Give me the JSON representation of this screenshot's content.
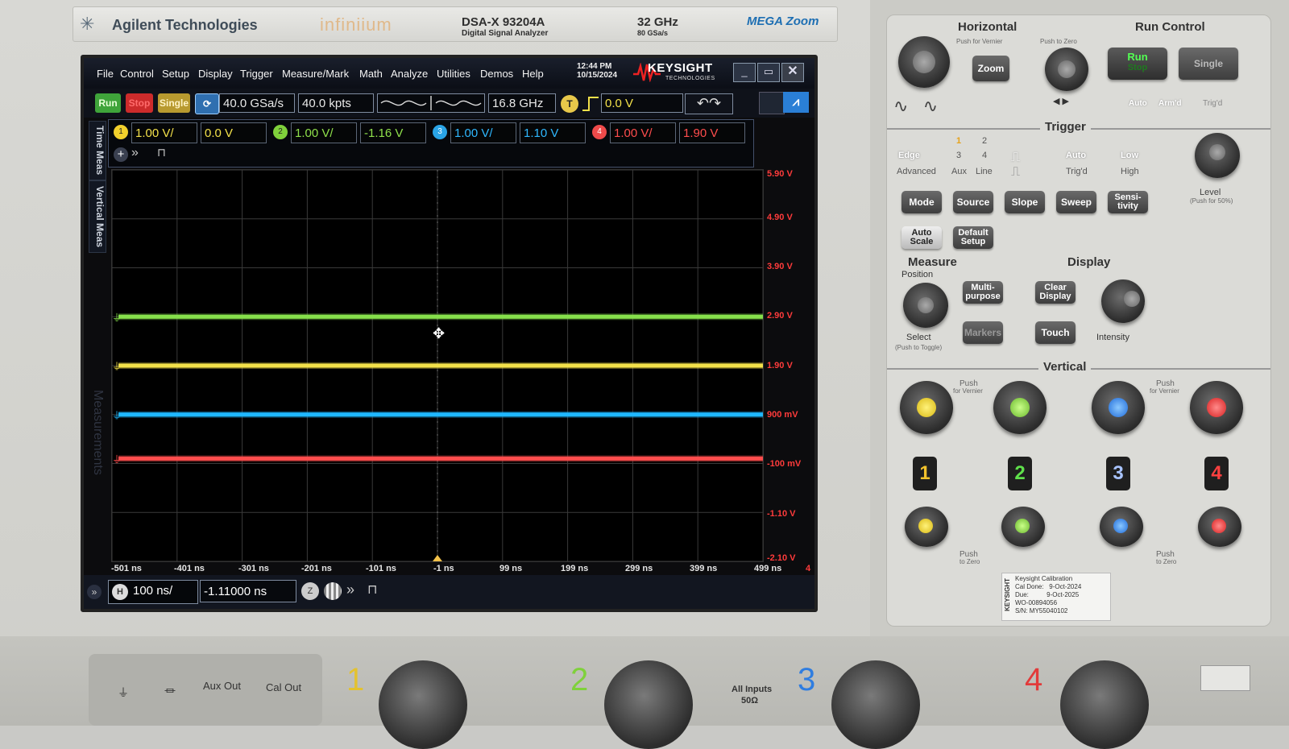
{
  "brand": {
    "company": "Agilent Technologies",
    "product_line": "infiniium",
    "model": "DSA-X 93204A",
    "model_sub": "Digital Signal Analyzer",
    "bandwidth": "32 GHz",
    "rate": "80 GSa/s",
    "megazoom": "MEGA Zoom"
  },
  "menu": [
    "File",
    "Control",
    "Setup",
    "Display",
    "Trigger",
    "Measure/Mark",
    "Math",
    "Analyze",
    "Utilities",
    "Demos",
    "Help"
  ],
  "clock": {
    "time": "12:44 PM",
    "date": "10/15/2024"
  },
  "keysight": {
    "name": "KEYSIGHT",
    "sub": "TECHNOLOGIES"
  },
  "window_buttons": {
    "minimize": "_",
    "restore": "▭",
    "close": "✕"
  },
  "toolbar": {
    "run": "Run",
    "stop": "Stop",
    "single": "Single",
    "sample_rate": "40.0 GSa/s",
    "memory": "40.0 kpts",
    "bandwidth": "16.8 GHz",
    "trigger_badge": "T",
    "trigger_level": "0.0 V"
  },
  "channels": [
    {
      "num": "1",
      "scale": "1.00 V/",
      "offset": "0.0 V",
      "color": "#f2d02c"
    },
    {
      "num": "2",
      "scale": "1.00 V/",
      "offset": "-1.16 V",
      "color": "#7fd13b"
    },
    {
      "num": "3",
      "scale": "1.00 V/",
      "offset": "1.10 V",
      "color": "#2aa4e6"
    },
    {
      "num": "4",
      "scale": "1.00 V/",
      "offset": "1.90 V",
      "color": "#ee4a4a"
    }
  ],
  "side_tabs": {
    "time_meas": "Time Meas",
    "vertical_meas": "Vertical Meas",
    "measurements": "Measurements"
  },
  "plot": {
    "y_labels": [
      "5.90 V",
      "4.90 V",
      "3.90 V",
      "2.90 V",
      "1.90 V",
      "900 mV",
      "-100 mV",
      "-1.10 V",
      "-2.10 V"
    ],
    "x_labels": [
      "-501 ns",
      "-401 ns",
      "-301 ns",
      "-201 ns",
      "-101 ns",
      "-1 ns",
      "99 ns",
      "199 ns",
      "299 ns",
      "399 ns",
      "499 ns"
    ],
    "corner_label": "4",
    "traces": [
      {
        "channel": "2",
        "level_v": 2.9,
        "color": "#86e04b"
      },
      {
        "channel": "1",
        "level_v": 1.9,
        "color": "#f3e14a"
      },
      {
        "channel": "3",
        "level_v": 0.9,
        "color": "#1fb8ff"
      },
      {
        "channel": "4",
        "level_v": 0.0,
        "color": "#ff4d4d"
      }
    ],
    "y_max": 5.9,
    "y_min": -2.1
  },
  "bottom": {
    "h_badge": "H",
    "time_scale": "100 ns/",
    "time_delay": "-1.11000 ns"
  },
  "panel": {
    "horizontal": "Horizontal",
    "run_control": "Run Control",
    "push_vernier": "Push for Vernier",
    "push_zero": "Push to Zero",
    "zoom": "Zoom",
    "run": "Run",
    "stop": "Stop",
    "single": "Single",
    "auto": "Auto",
    "armed": "Arm'd",
    "trigd": "Trig'd",
    "trigger": "Trigger",
    "edge": "Edge",
    "advanced": "Advanced",
    "src1": "1",
    "src2": "2",
    "src3": "3",
    "src4": "4",
    "aux": "Aux",
    "line": "Line",
    "trig_auto": "Auto",
    "trig_trigd": "Trig'd",
    "low": "Low",
    "high": "High",
    "level": "Level",
    "level_sub": "(Push for 50%)",
    "mode": "Mode",
    "source": "Source",
    "slope": "Slope",
    "sweep": "Sweep",
    "sensitivity": "Sensi-tivity",
    "auto_scale": "Auto Scale",
    "default_setup": "Default Setup",
    "measure": "Measure",
    "display": "Display",
    "position": "Position",
    "multipurpose": "Multi-purpose",
    "clear_display": "Clear Display",
    "markers": "Markers",
    "touch": "Touch",
    "select": "Select",
    "select_sub": "(Push to Toggle)",
    "intensity": "Intensity",
    "vertical": "Vertical",
    "push": "Push",
    "for_vernier": "for Vernier",
    "to_zero": "to Zero",
    "cal_brand": "KEYSIGHT",
    "cal_title": "Keysight Calibration",
    "cal_done": "Cal Done:   9-Oct-2024",
    "cal_due": "Due:          9-Oct-2025",
    "cal_wo": "WO-00894056",
    "cal_sn": "S/N: MY55040102"
  },
  "lower": {
    "aux_out": "Aux Out",
    "cal_out": "Cal Out",
    "all_inputs": "All Inputs",
    "ohm": "50Ω",
    "n1": "1",
    "n2": "2",
    "n3": "3",
    "n4": "4"
  }
}
